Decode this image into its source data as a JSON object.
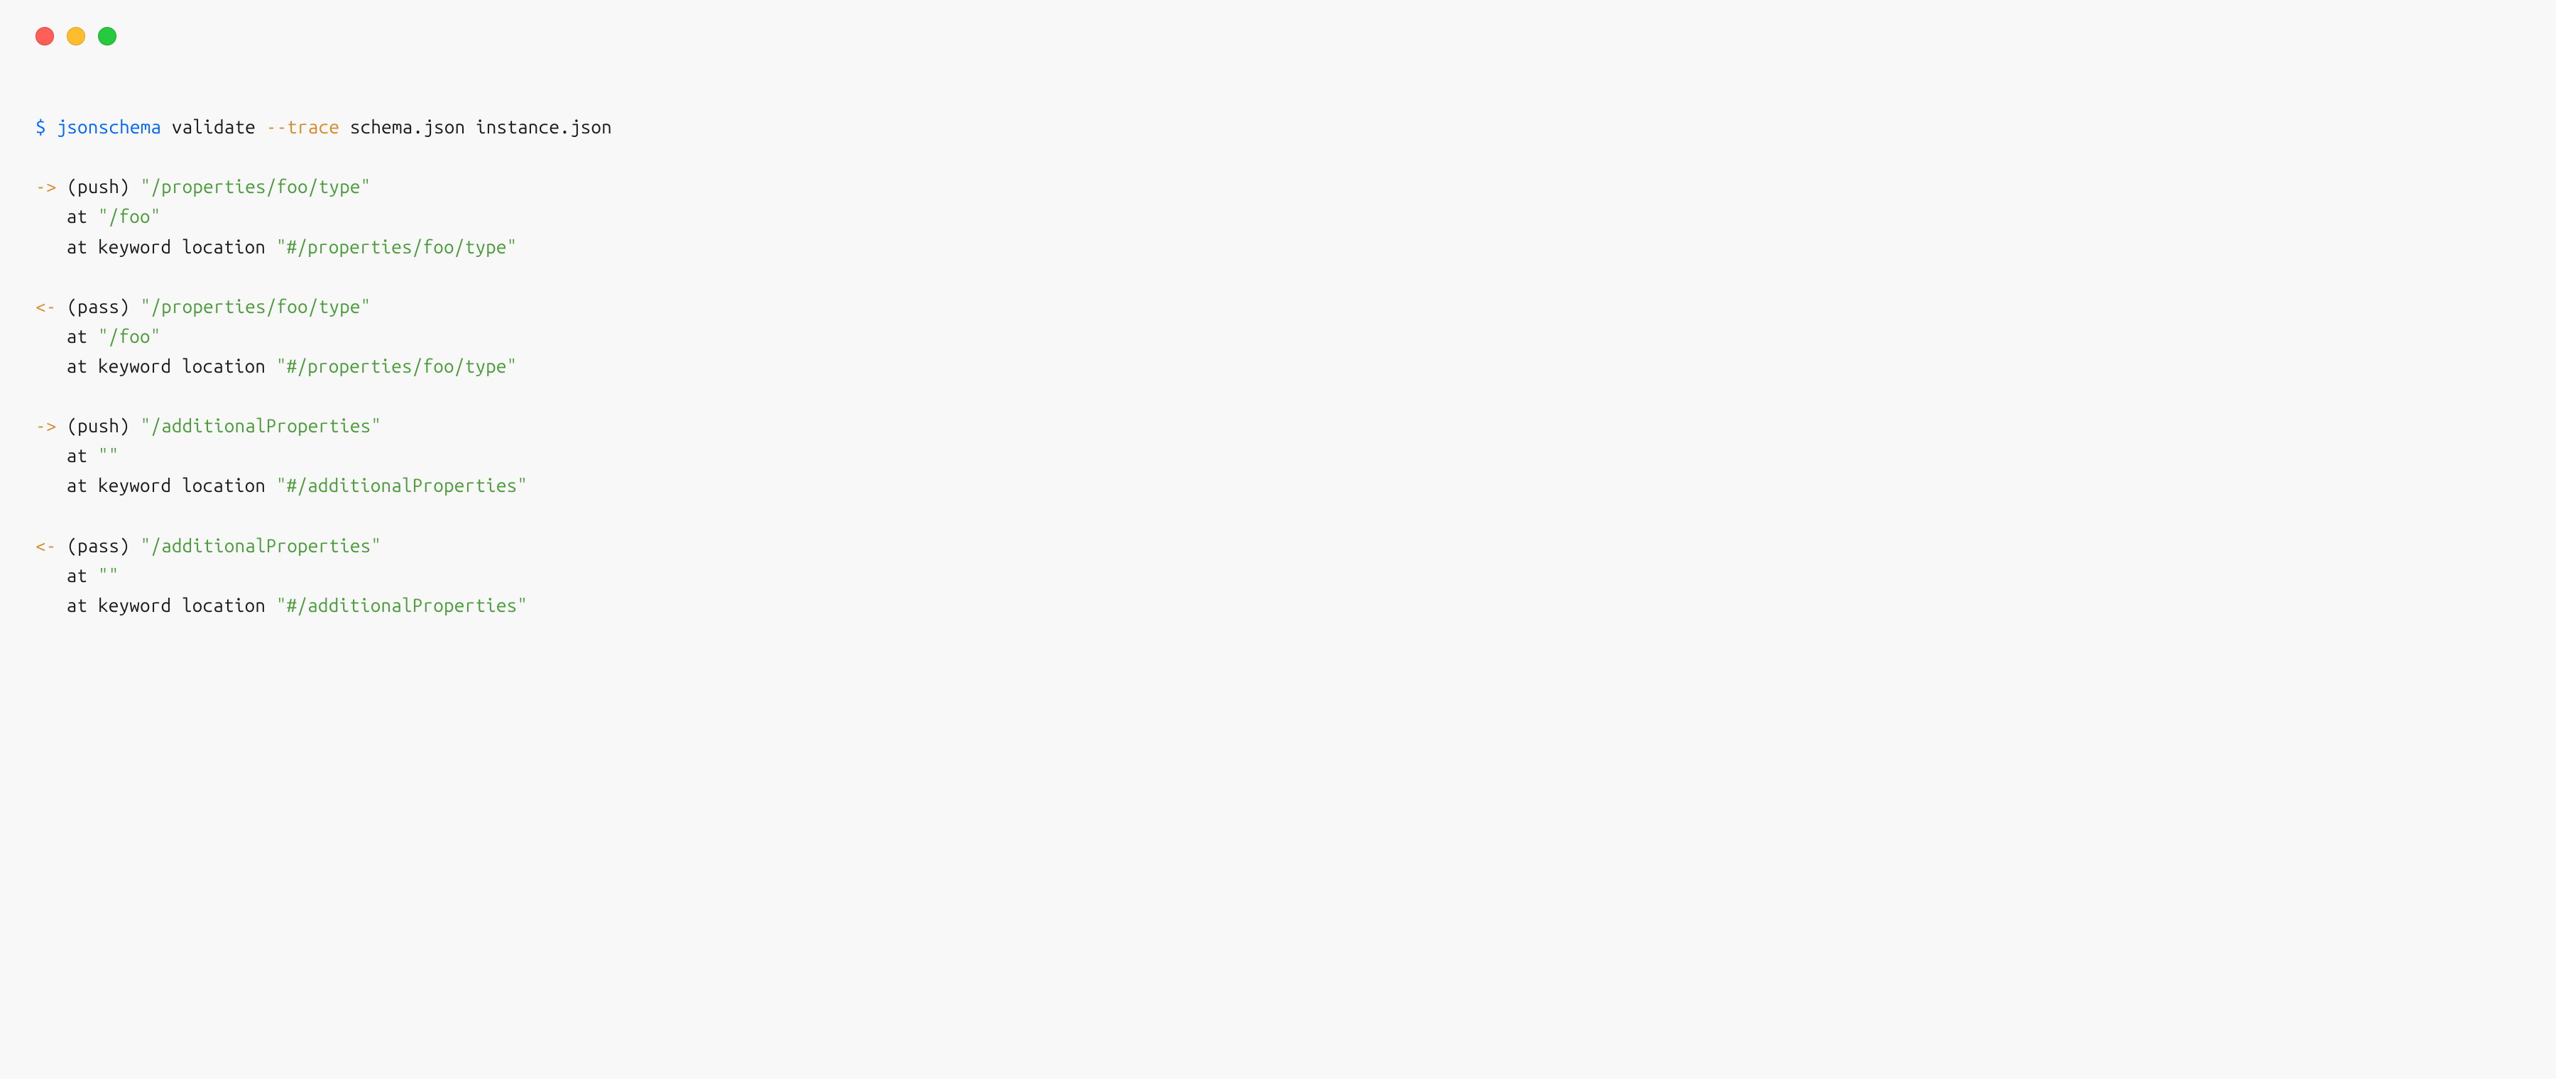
{
  "window": {
    "traffic_lights": {
      "red": "#ff5f56",
      "yellow": "#ffbd2e",
      "green": "#27c93f"
    }
  },
  "prompt": {
    "symbol": "$",
    "command": "jsonschema",
    "subcommand": "validate",
    "flag": "--trace",
    "arg1": "schema.json",
    "arg2": "instance.json"
  },
  "traces": [
    {
      "arrow": "->",
      "action": "(push)",
      "path": "\"/properties/foo/type\"",
      "at_label": "at",
      "at_path": "\"/foo\"",
      "kl_label": "at keyword location",
      "kl_path": "\"#/properties/foo/type\""
    },
    {
      "arrow": "<-",
      "action": "(pass)",
      "path": "\"/properties/foo/type\"",
      "at_label": "at",
      "at_path": "\"/foo\"",
      "kl_label": "at keyword location",
      "kl_path": "\"#/properties/foo/type\""
    },
    {
      "arrow": "->",
      "action": "(push)",
      "path": "\"/additionalProperties\"",
      "at_label": "at",
      "at_path": "\"\"",
      "kl_label": "at keyword location",
      "kl_path": "\"#/additionalProperties\""
    },
    {
      "arrow": "<-",
      "action": "(pass)",
      "path": "\"/additionalProperties\"",
      "at_label": "at",
      "at_path": "\"\"",
      "kl_label": "at keyword location",
      "kl_path": "\"#/additionalProperties\""
    }
  ]
}
